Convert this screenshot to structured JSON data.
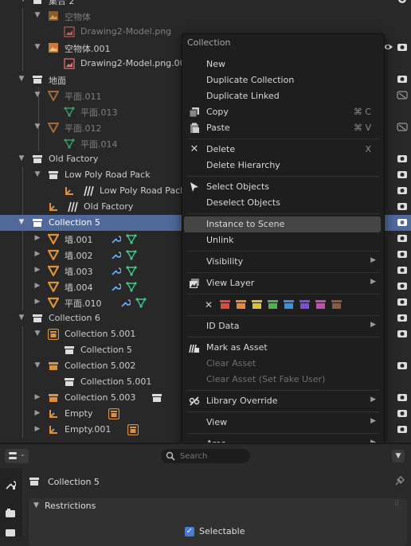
{
  "outliner": {
    "rows": [
      {
        "label": "集合 2"
      },
      {
        "label": "空物体"
      },
      {
        "label": "Drawing2-Model.png"
      },
      {
        "label": "空物体.001"
      },
      {
        "label": "Drawing2-Model.png.00"
      },
      {
        "label": "地面"
      },
      {
        "label": "平面.011"
      },
      {
        "label": "平面.013"
      },
      {
        "label": "平面.012"
      },
      {
        "label": "平面.014"
      },
      {
        "label": "Old Factory"
      },
      {
        "label": "Low Poly Road Pack"
      },
      {
        "label": "Low Poly Road Pack"
      },
      {
        "label": "Old Factory"
      },
      {
        "label": "Collection 5"
      },
      {
        "label": "墙.001"
      },
      {
        "label": "墙.002"
      },
      {
        "label": "墙.003"
      },
      {
        "label": "墙.004"
      },
      {
        "label": "平面.010"
      },
      {
        "label": "Collection 6"
      },
      {
        "label": "Collection 5.001"
      },
      {
        "label": "Collection 5"
      },
      {
        "label": "Collection 5.002"
      },
      {
        "label": "Collection 5.001"
      },
      {
        "label": "Collection 5.003"
      },
      {
        "label": "Empty"
      },
      {
        "label": "Empty.001"
      }
    ]
  },
  "context_menu": {
    "title": "Collection",
    "items": {
      "new": "New",
      "duplicate_collection": "Duplicate Collection",
      "duplicate_linked": "Duplicate Linked",
      "copy": "Copy",
      "copy_shortcut": "⌘ C",
      "paste": "Paste",
      "paste_shortcut": "⌘ V",
      "delete": "Delete",
      "delete_shortcut": "X",
      "delete_hierarchy": "Delete Hierarchy",
      "select_objects": "Select Objects",
      "deselect_objects": "Deselect Objects",
      "instance_to_scene": "Instance to Scene",
      "unlink": "Unlink",
      "visibility": "Visibility",
      "view_layer": "View Layer",
      "id_data": "ID Data",
      "mark_as_asset": "Mark as Asset",
      "clear_asset": "Clear Asset",
      "clear_asset_fake": "Clear Asset (Set Fake User)",
      "library_override": "Library Override",
      "view": "View",
      "area": "Area"
    },
    "color_tags": [
      "#e0493f",
      "#e8893a",
      "#dcc23a",
      "#4fb24c",
      "#3f8fde",
      "#7b4fd6",
      "#c04fb2",
      "#8a5b3c"
    ]
  },
  "properties": {
    "search_placeholder": "Search",
    "collection_name": "Collection 5",
    "restrictions_label": "Restrictions",
    "selectable_label": "Selectable"
  },
  "colors": {
    "accent_selection": "#4f6a9a",
    "menu_highlight": "#454545",
    "object_orange": "#e0903a",
    "mesh_green": "#3ec78a",
    "wrench_blue": "#6aa8e8"
  }
}
